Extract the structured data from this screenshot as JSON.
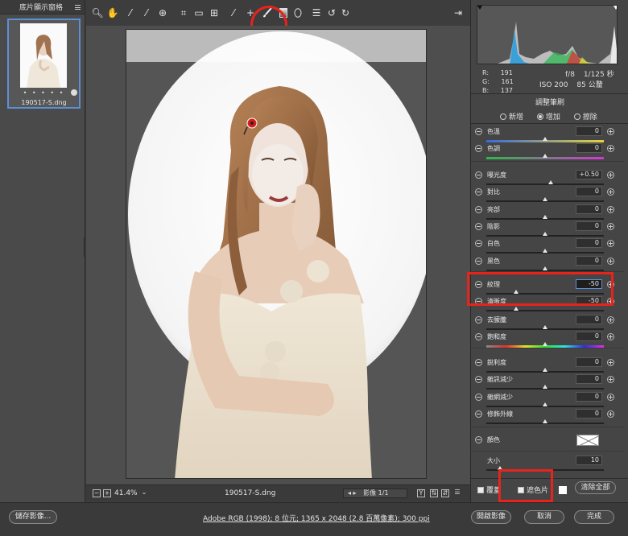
{
  "filmstrip": {
    "title": "底片顯示窗格",
    "thumb_name": "190517-S.dng",
    "rating_dots": "• • • • •"
  },
  "toolbar": {
    "icons": [
      "zoom-icon",
      "hand-icon",
      "white-balance-icon",
      "color-sampler-icon",
      "targeted-adjust-icon",
      "crop-icon",
      "straighten-icon",
      "transform-icon",
      "spot-removal-icon",
      "red-eye-icon",
      "adjustment-brush-icon",
      "graduated-filter-icon",
      "radial-filter-icon",
      "list-icon",
      "rotate-left-icon",
      "rotate-right-icon",
      "fullscreen-icon"
    ],
    "highlight": "adjustment-brush-icon"
  },
  "status": {
    "zoom": "41.4%",
    "filename": "190517-S.dng",
    "image_nav": "影像 1/1",
    "y_btn": "Y"
  },
  "info": {
    "r_label": "R:",
    "r_val": "191",
    "g_label": "G:",
    "g_val": "161",
    "b_label": "B:",
    "b_val": "137",
    "aperture": "f/8",
    "shutter": "1/125 秒",
    "iso": "ISO 200",
    "focal": "85 公釐"
  },
  "panel": {
    "title": "調整筆刷",
    "mode_new": "新增",
    "mode_add": "增加",
    "mode_erase": "擦除",
    "mode_selected": "增加",
    "sliders": [
      {
        "label": "色溫",
        "value": "0",
        "pos": 0.5
      },
      {
        "label": "色調",
        "value": "0",
        "pos": 0.5
      },
      {
        "label": "曝光度",
        "value": "+0.50",
        "pos": 0.55
      },
      {
        "label": "對比",
        "value": "0",
        "pos": 0.5
      },
      {
        "label": "亮部",
        "value": "0",
        "pos": 0.5
      },
      {
        "label": "陰影",
        "value": "0",
        "pos": 0.5
      },
      {
        "label": "白色",
        "value": "0",
        "pos": 0.5
      },
      {
        "label": "黑色",
        "value": "0",
        "pos": 0.5
      },
      {
        "label": "紋理",
        "value": "-50",
        "pos": 0.25
      },
      {
        "label": "清晰度",
        "value": "-50",
        "pos": 0.25
      },
      {
        "label": "去朦朧",
        "value": "0",
        "pos": 0.5
      },
      {
        "label": "飽和度",
        "value": "0",
        "pos": 0.5
      },
      {
        "label": "銳利度",
        "value": "0",
        "pos": 0.5
      },
      {
        "label": "雜訊減少",
        "value": "0",
        "pos": 0.5
      },
      {
        "label": "雜網減少",
        "value": "0",
        "pos": 0.5
      },
      {
        "label": "修飾外線",
        "value": "0",
        "pos": 0.5
      }
    ],
    "color_label": "顏色",
    "size_label": "大小",
    "size_value": "10",
    "overlay_label": "覆蓋",
    "mask_label": "遮色片",
    "clear_all": "清除全部"
  },
  "bottom": {
    "save": "儲存影像...",
    "workflow": "Adobe RGB (1998); 8 位元; 1365 x 2048 (2.8 百萬像素); 300 ppi",
    "open": "開啟影像",
    "cancel": "取消",
    "done": "完成"
  },
  "colors": {
    "highlight_red": "#e8231c",
    "selection_blue": "#5c8fd6",
    "mask_pin": "#d81b1b"
  }
}
